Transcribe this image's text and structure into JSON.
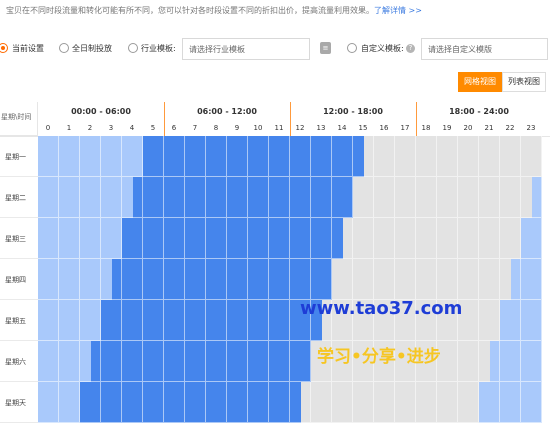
{
  "intro": {
    "text": "宝贝在不同时段流量和转化可能有所不同，您可以针对各时段设置不同的折扣出价，提高流量利用效果。",
    "link": "了解详情 >>"
  },
  "options": {
    "current": "当前设置",
    "all_day": "全日制投放",
    "industry": "行业模板:",
    "industry_select": "请选择行业模板",
    "custom": "自定义模板:",
    "custom_select": "请选择自定义模版",
    "help_icon": "?"
  },
  "view": {
    "grid": "网格视图",
    "list": "列表视图",
    "selected": "grid"
  },
  "grid": {
    "corner": "星期\\时间",
    "groups": [
      "00:00 - 06:00",
      "06:00 - 12:00",
      "12:00 - 18:00",
      "18:00 - 24:00"
    ],
    "hours": [
      "0",
      "1",
      "2",
      "3",
      "4",
      "5",
      "6",
      "7",
      "8",
      "9",
      "10",
      "11",
      "12",
      "13",
      "14",
      "15",
      "16",
      "17",
      "18",
      "19",
      "20",
      "21",
      "22",
      "23"
    ],
    "days": [
      {
        "label": "星期一",
        "light_end": 10.5,
        "dark_end": 31.0,
        "light2_start": 47.5
      },
      {
        "label": "星期二",
        "light_end": 9.5,
        "dark_end": 30.0,
        "light2_start": 46.5
      },
      {
        "label": "星期三",
        "light_end": 8.5,
        "dark_end": 29.0,
        "light2_start": 45.5
      },
      {
        "label": "星期四",
        "light_end": 7.5,
        "dark_end": 28.0,
        "light2_start": 44.5
      },
      {
        "label": "星期五",
        "light_end": 6.5,
        "dark_end": 27.0,
        "light2_start": 43.5
      },
      {
        "label": "星期六",
        "light_end": 5.5,
        "dark_end": 26.0,
        "light2_start": 42.5
      },
      {
        "label": "星期天",
        "light_end": 4.5,
        "dark_end": 25.0,
        "light2_start": 41.5
      }
    ],
    "colors": {
      "light": "#a9c9fb",
      "dark": "#4585ec",
      "gray": "#e3e3e3"
    }
  },
  "watermark": {
    "url": "www.tao37.com",
    "slogan": "学习•分享•进步"
  }
}
